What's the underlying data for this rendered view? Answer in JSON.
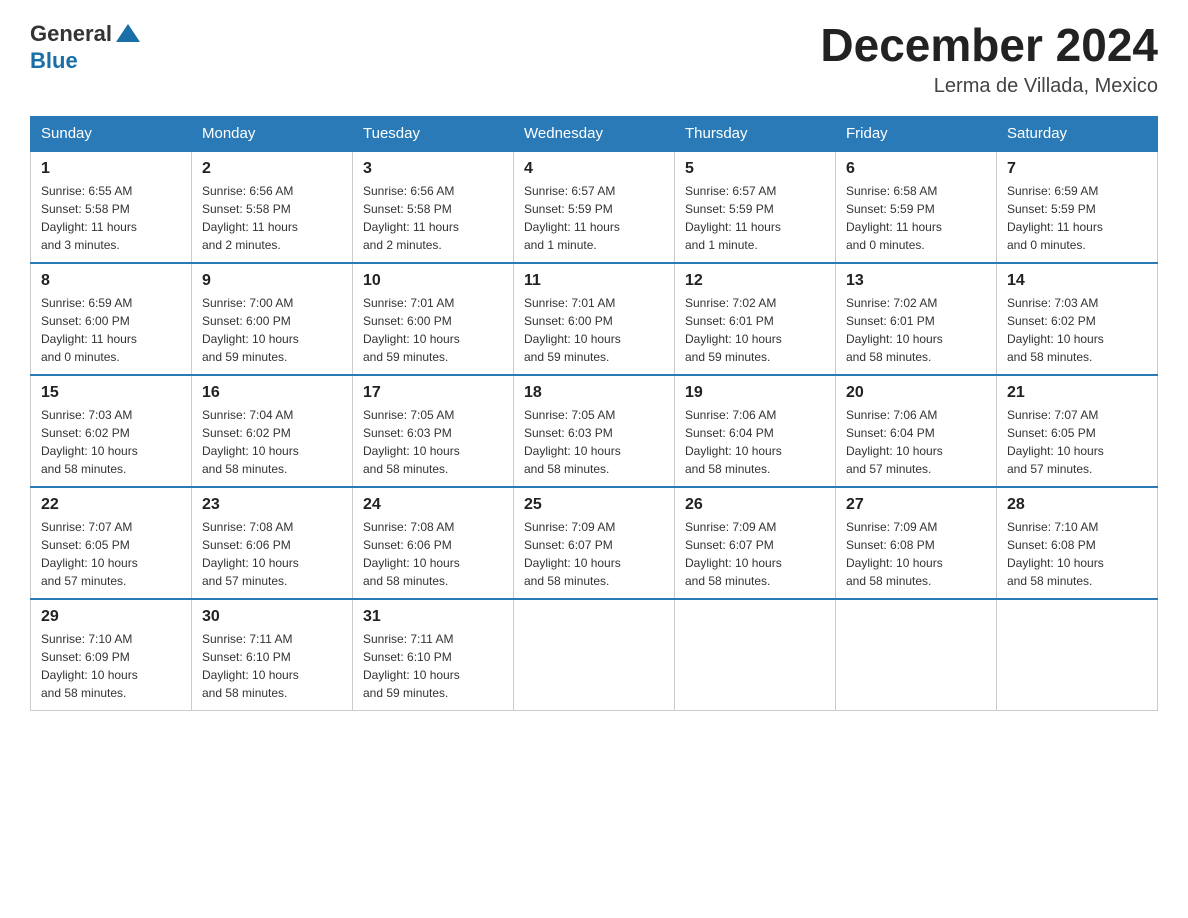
{
  "logo": {
    "general": "General",
    "blue": "Blue"
  },
  "header": {
    "month": "December 2024",
    "location": "Lerma de Villada, Mexico"
  },
  "days_of_week": [
    "Sunday",
    "Monday",
    "Tuesday",
    "Wednesday",
    "Thursday",
    "Friday",
    "Saturday"
  ],
  "weeks": [
    [
      {
        "day": "1",
        "sunrise": "6:55 AM",
        "sunset": "5:58 PM",
        "daylight": "11 hours and 3 minutes."
      },
      {
        "day": "2",
        "sunrise": "6:56 AM",
        "sunset": "5:58 PM",
        "daylight": "11 hours and 2 minutes."
      },
      {
        "day": "3",
        "sunrise": "6:56 AM",
        "sunset": "5:58 PM",
        "daylight": "11 hours and 2 minutes."
      },
      {
        "day": "4",
        "sunrise": "6:57 AM",
        "sunset": "5:59 PM",
        "daylight": "11 hours and 1 minute."
      },
      {
        "day": "5",
        "sunrise": "6:57 AM",
        "sunset": "5:59 PM",
        "daylight": "11 hours and 1 minute."
      },
      {
        "day": "6",
        "sunrise": "6:58 AM",
        "sunset": "5:59 PM",
        "daylight": "11 hours and 0 minutes."
      },
      {
        "day": "7",
        "sunrise": "6:59 AM",
        "sunset": "5:59 PM",
        "daylight": "11 hours and 0 minutes."
      }
    ],
    [
      {
        "day": "8",
        "sunrise": "6:59 AM",
        "sunset": "6:00 PM",
        "daylight": "11 hours and 0 minutes."
      },
      {
        "day": "9",
        "sunrise": "7:00 AM",
        "sunset": "6:00 PM",
        "daylight": "10 hours and 59 minutes."
      },
      {
        "day": "10",
        "sunrise": "7:01 AM",
        "sunset": "6:00 PM",
        "daylight": "10 hours and 59 minutes."
      },
      {
        "day": "11",
        "sunrise": "7:01 AM",
        "sunset": "6:00 PM",
        "daylight": "10 hours and 59 minutes."
      },
      {
        "day": "12",
        "sunrise": "7:02 AM",
        "sunset": "6:01 PM",
        "daylight": "10 hours and 59 minutes."
      },
      {
        "day": "13",
        "sunrise": "7:02 AM",
        "sunset": "6:01 PM",
        "daylight": "10 hours and 58 minutes."
      },
      {
        "day": "14",
        "sunrise": "7:03 AM",
        "sunset": "6:02 PM",
        "daylight": "10 hours and 58 minutes."
      }
    ],
    [
      {
        "day": "15",
        "sunrise": "7:03 AM",
        "sunset": "6:02 PM",
        "daylight": "10 hours and 58 minutes."
      },
      {
        "day": "16",
        "sunrise": "7:04 AM",
        "sunset": "6:02 PM",
        "daylight": "10 hours and 58 minutes."
      },
      {
        "day": "17",
        "sunrise": "7:05 AM",
        "sunset": "6:03 PM",
        "daylight": "10 hours and 58 minutes."
      },
      {
        "day": "18",
        "sunrise": "7:05 AM",
        "sunset": "6:03 PM",
        "daylight": "10 hours and 58 minutes."
      },
      {
        "day": "19",
        "sunrise": "7:06 AM",
        "sunset": "6:04 PM",
        "daylight": "10 hours and 58 minutes."
      },
      {
        "day": "20",
        "sunrise": "7:06 AM",
        "sunset": "6:04 PM",
        "daylight": "10 hours and 57 minutes."
      },
      {
        "day": "21",
        "sunrise": "7:07 AM",
        "sunset": "6:05 PM",
        "daylight": "10 hours and 57 minutes."
      }
    ],
    [
      {
        "day": "22",
        "sunrise": "7:07 AM",
        "sunset": "6:05 PM",
        "daylight": "10 hours and 57 minutes."
      },
      {
        "day": "23",
        "sunrise": "7:08 AM",
        "sunset": "6:06 PM",
        "daylight": "10 hours and 57 minutes."
      },
      {
        "day": "24",
        "sunrise": "7:08 AM",
        "sunset": "6:06 PM",
        "daylight": "10 hours and 58 minutes."
      },
      {
        "day": "25",
        "sunrise": "7:09 AM",
        "sunset": "6:07 PM",
        "daylight": "10 hours and 58 minutes."
      },
      {
        "day": "26",
        "sunrise": "7:09 AM",
        "sunset": "6:07 PM",
        "daylight": "10 hours and 58 minutes."
      },
      {
        "day": "27",
        "sunrise": "7:09 AM",
        "sunset": "6:08 PM",
        "daylight": "10 hours and 58 minutes."
      },
      {
        "day": "28",
        "sunrise": "7:10 AM",
        "sunset": "6:08 PM",
        "daylight": "10 hours and 58 minutes."
      }
    ],
    [
      {
        "day": "29",
        "sunrise": "7:10 AM",
        "sunset": "6:09 PM",
        "daylight": "10 hours and 58 minutes."
      },
      {
        "day": "30",
        "sunrise": "7:11 AM",
        "sunset": "6:10 PM",
        "daylight": "10 hours and 58 minutes."
      },
      {
        "day": "31",
        "sunrise": "7:11 AM",
        "sunset": "6:10 PM",
        "daylight": "10 hours and 59 minutes."
      },
      null,
      null,
      null,
      null
    ]
  ],
  "labels": {
    "sunrise": "Sunrise:",
    "sunset": "Sunset:",
    "daylight": "Daylight:"
  }
}
